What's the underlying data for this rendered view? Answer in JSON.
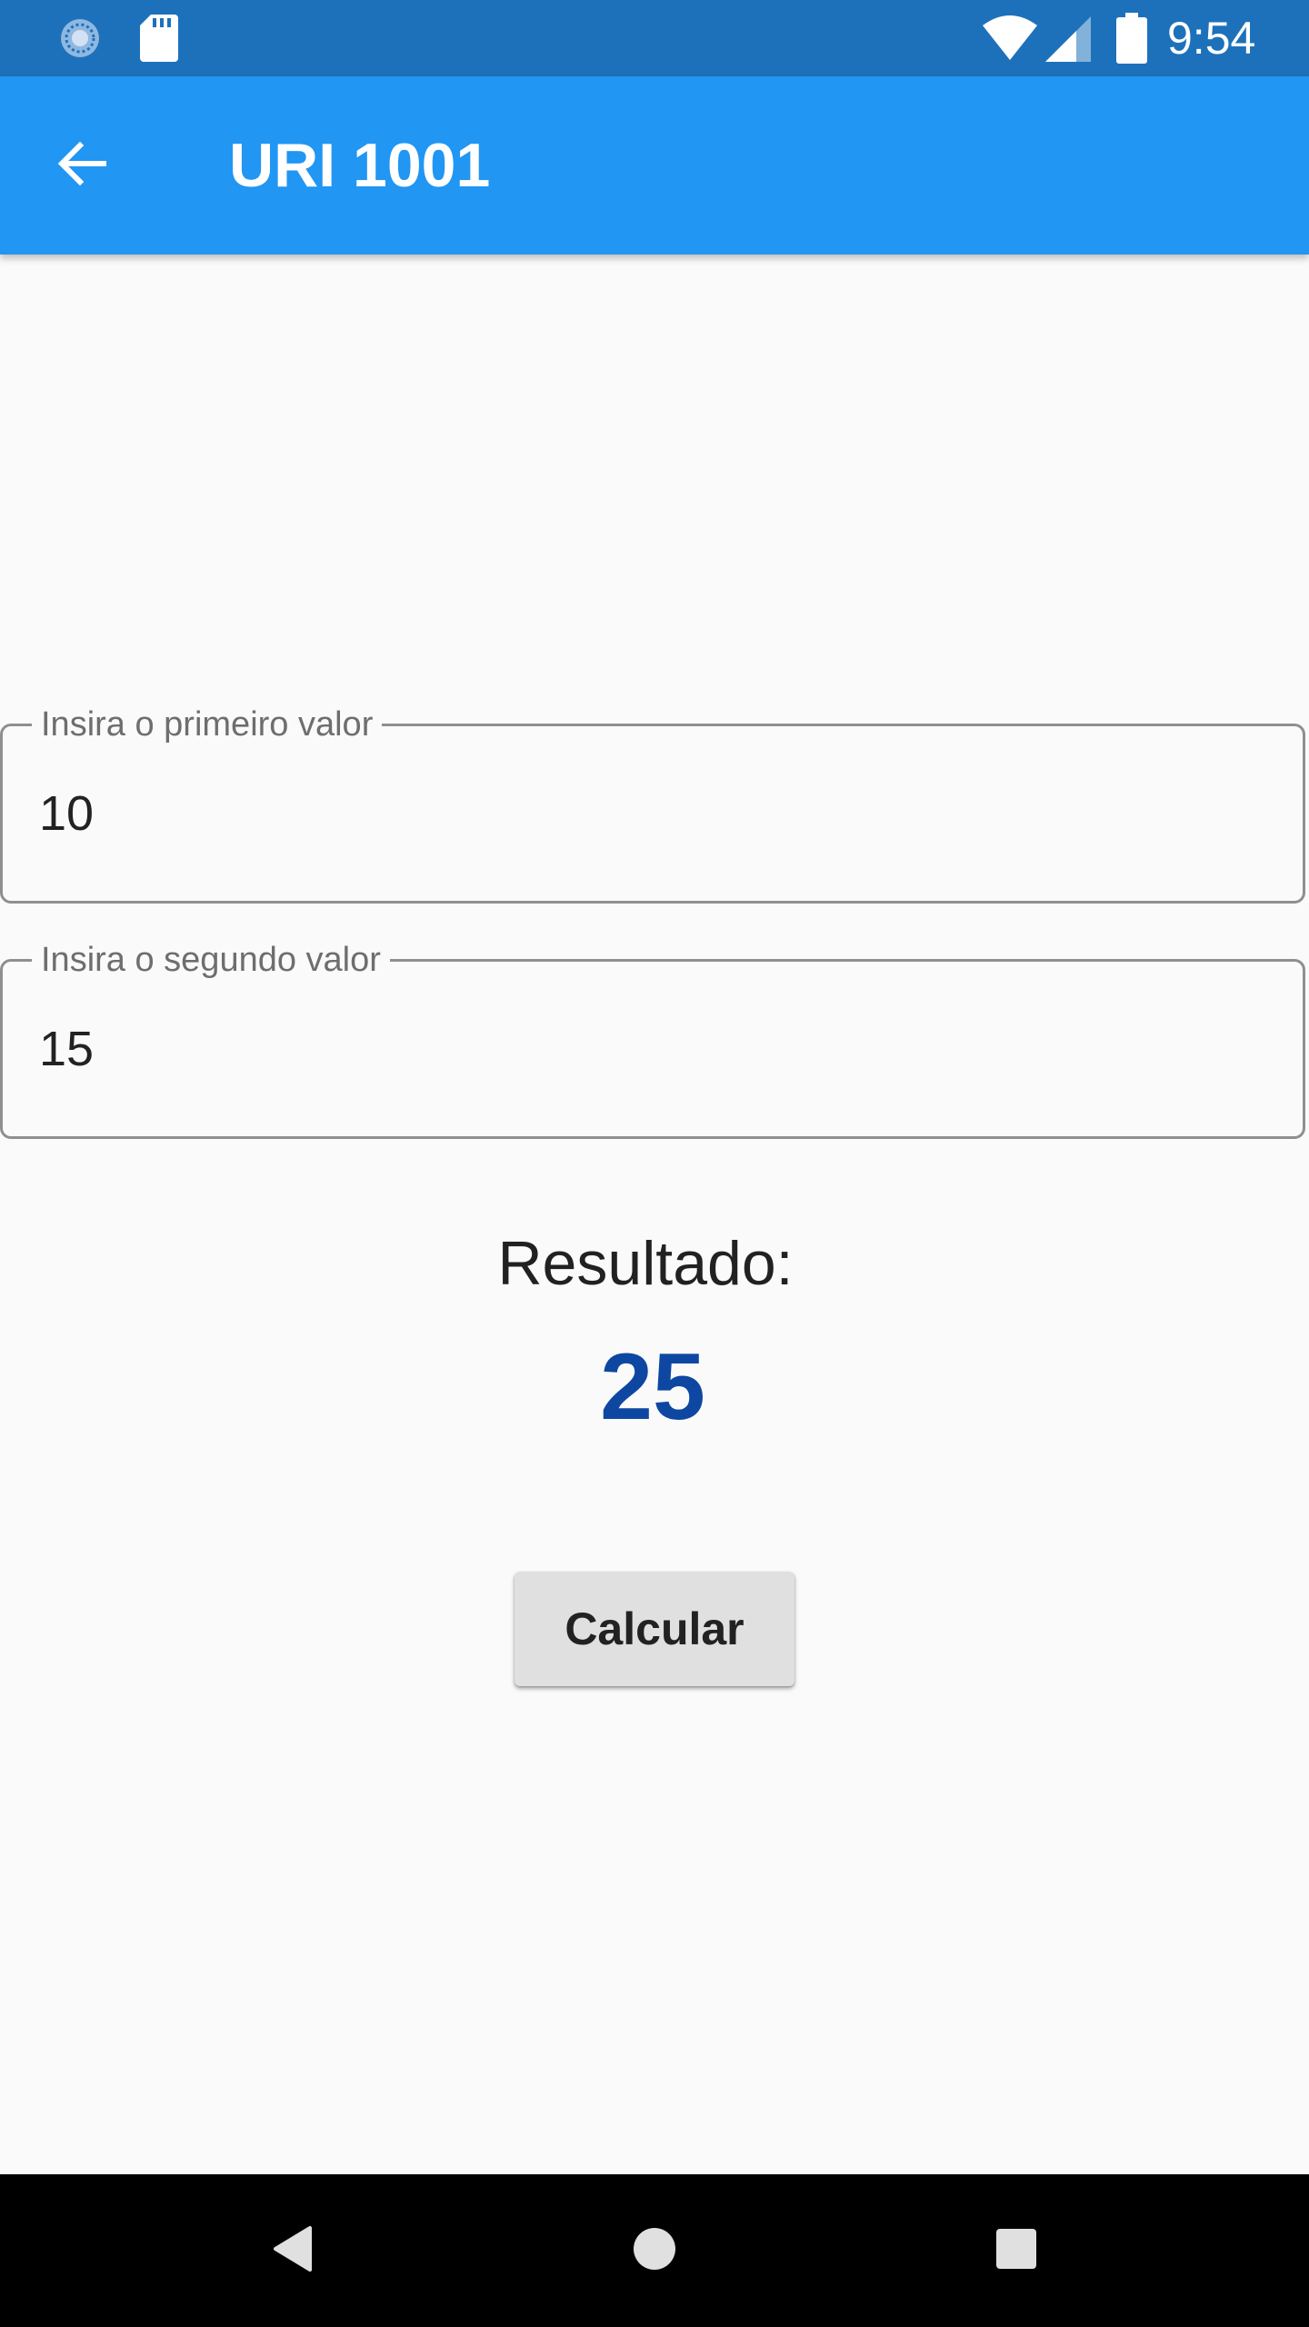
{
  "status_bar": {
    "time": "9:54",
    "icons": [
      "sync-icon",
      "sd-card-icon",
      "wifi-icon",
      "cell-signal-icon",
      "battery-icon"
    ]
  },
  "app_bar": {
    "title": "URI 1001",
    "back_icon": "arrow-back-icon",
    "color": "#2196f3"
  },
  "form": {
    "first": {
      "label": "Insira o primeiro valor",
      "value": "10"
    },
    "second": {
      "label": "Insira o segundo valor",
      "value": "15"
    }
  },
  "result": {
    "label": "Resultado:",
    "value": "25",
    "color": "#0d47a1"
  },
  "actions": {
    "calculate_label": "Calcular"
  },
  "nav_bar": {
    "icons": [
      "nav-back-icon",
      "nav-home-icon",
      "nav-recents-icon"
    ]
  }
}
